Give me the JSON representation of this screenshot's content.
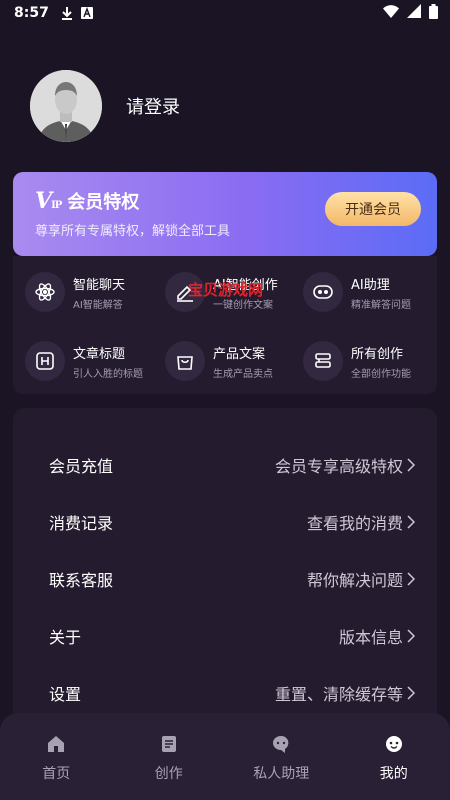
{
  "status_bar": {
    "time": "8:57"
  },
  "profile": {
    "login_text": "请登录"
  },
  "vip": {
    "logo": "V",
    "logo_small": "IP",
    "title": "会员特权",
    "subtitle": "尊享所有专属特权，解锁全部工具",
    "button": "开通会员"
  },
  "features": [
    {
      "title": "智能聊天",
      "desc": "AI智能解答",
      "icon": "atom-icon"
    },
    {
      "title": "AI智能创作",
      "desc": "一键创作文案",
      "icon": "pen-icon"
    },
    {
      "title": "AI助理",
      "desc": "精准解答问题",
      "icon": "robot-icon"
    },
    {
      "title": "文章标题",
      "desc": "引人入胜的标题",
      "icon": "heading-icon"
    },
    {
      "title": "产品文案",
      "desc": "生成产品卖点",
      "icon": "bag-icon"
    },
    {
      "title": "所有创作",
      "desc": "全部创作功能",
      "icon": "stack-icon"
    }
  ],
  "watermark": "宝贝游戏网",
  "menu": [
    {
      "label": "会员充值",
      "value": "会员专享高级特权"
    },
    {
      "label": "消费记录",
      "value": "查看我的消费"
    },
    {
      "label": "联系客服",
      "value": "帮你解决问题"
    },
    {
      "label": "关于",
      "value": "版本信息"
    },
    {
      "label": "设置",
      "value": "重置、清除缓存等"
    }
  ],
  "nav": [
    {
      "label": "首页",
      "icon": "home-icon"
    },
    {
      "label": "创作",
      "icon": "document-icon"
    },
    {
      "label": "私人助理",
      "icon": "chat-icon"
    },
    {
      "label": "我的",
      "icon": "profile-icon",
      "active": true
    }
  ],
  "colors": {
    "background": "#1b1424",
    "card": "#241c2e",
    "vip_gradient_start": "#a98bf0",
    "vip_gradient_end": "#5b6cf6",
    "vip_button": "#f3b869",
    "watermark": "#e0242c"
  }
}
